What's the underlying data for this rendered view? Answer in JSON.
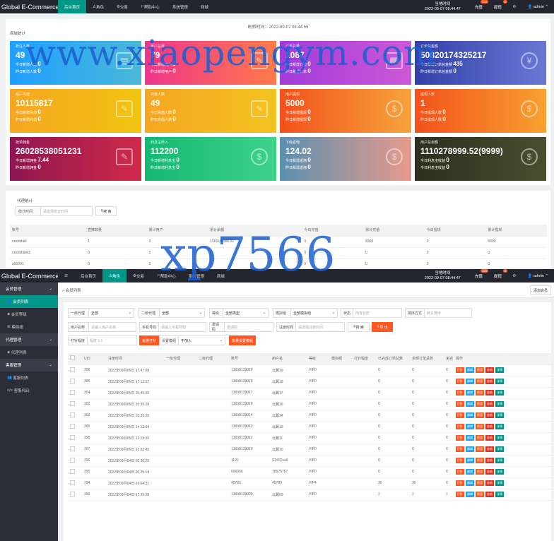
{
  "app_title": "Global E-Commerce...",
  "nav": [
    "后台首页",
    "角色",
    "交易",
    "帮助中心",
    "系统管理",
    "商城"
  ],
  "nav2": [
    "后台首页",
    "角色",
    "交易",
    "帮助中心",
    "系统管理",
    "商城"
  ],
  "header": {
    "time_label": "当地时间",
    "time_value": "2022-09-07 08:44:47",
    "recharge": "充值",
    "recharge_badge": "123",
    "withdraw": "提现",
    "withdraw_badge": "0",
    "user": "admin",
    "refresh_icon": "refresh-icon"
  },
  "dashboard": {
    "refresh_time": "刷新时间：2022-09-07 08:44:55",
    "section_title": "商城统计",
    "cards": [
      {
        "title": "新注人数",
        "value": "49",
        "l1": "今日新增人数",
        "l1v": "0",
        "l2": "昨日新增人数",
        "l2v": "0",
        "icon": "stack-icon",
        "color": "#1e9fff,#4bb8d8"
      },
      {
        "title": "用户总数",
        "value": "79",
        "l1": "今日新增用户",
        "l1v": "0",
        "l2": "昨日新增用户",
        "l2v": "0",
        "icon": "user-icon",
        "color": "#f0358c,#ff7a4a"
      },
      {
        "title": "订单总量",
        "value": "1087",
        "l1": "今日新增订单",
        "l1v": "0",
        "l2": "昨日新增订单",
        "l2v": "0",
        "icon": "book-icon",
        "color": "#a23bd8,#cc59d6"
      },
      {
        "title": "订单总金额",
        "value": "50820174325217",
        "l1": "今日新增订单总金额",
        "l1v": "435",
        "l2": "昨日新增订单总金额",
        "l2v": "0",
        "icon": "yen-icon",
        "color": "#3340a8,#6a78d4"
      },
      {
        "title": "用户充值",
        "value": "10115817",
        "l1": "今日新增充值",
        "l1v": "0",
        "l2": "昨日新增充值",
        "l2v": "0",
        "icon": "edit-icon",
        "color": "#f5a623,#f1c40f"
      },
      {
        "title": "充值人数",
        "value": "49",
        "l1": "今日充值人数",
        "l1v": "0",
        "l2": "昨日充值人数",
        "l2v": "0",
        "icon": "edit-icon",
        "color": "#f5a623,#f3c320"
      },
      {
        "title": "用户提现",
        "value": "5000",
        "l1": "今日新增提现",
        "l1v": "0",
        "l2": "昨日新增提现",
        "l2v": "0",
        "icon": "dollar-icon",
        "color": "#f2511b,#f7a33c"
      },
      {
        "title": "提现人数",
        "value": "1",
        "l1": "今日提现人数",
        "l1v": "0",
        "l2": "昨日提现人数",
        "l2v": "0",
        "icon": "dollar-icon",
        "color": "#f2511b,#f8a130"
      },
      {
        "title": "抢单佣金",
        "value": "26028538051231",
        "l1": "今日新增佣金",
        "l1v": "7.44",
        "l2": "昨日新增佣金",
        "l2v": "0",
        "icon": "user-icon",
        "color": "#8e1650,#d02a4a"
      },
      {
        "title": "利息宝转入",
        "value": "112200",
        "l1": "今日新增利息宝",
        "l1v": "0",
        "l2": "昨日新增利息宝",
        "l2v": "0",
        "icon": "dollar-icon",
        "color": "#14b874,#3fd28a"
      },
      {
        "title": "下级返佣",
        "value": "124.02",
        "l1": "今日新增返佣",
        "l1v": "0",
        "l2": "昨日新增返佣",
        "l2v": "0",
        "icon": "dollar-icon",
        "color": "#5b8fb0,#e89a8c"
      },
      {
        "title": "用户总余额",
        "value": "1110278999.52(9999)",
        "l1": "今日利息宝收益",
        "l1v": "0",
        "l2": "今日利息宝收益",
        "l2v": "0",
        "icon": "dollar-icon",
        "color": "#2c2f1c,#4a4e30"
      }
    ],
    "agent": {
      "title": "代理统计",
      "time_label": "统计时间",
      "time_placeholder": "请选择统计时间",
      "search_btn": "搜 索",
      "columns": [
        "账号",
        "直推数量",
        "累计用户",
        "累计余额",
        "今日充值",
        "累计充值",
        "今日提现",
        "累计提现"
      ],
      "rows": [
        [
          "ceshidaili",
          "1",
          "3",
          "1119145586.52",
          "0",
          "8300",
          "0",
          "5000"
        ],
        [
          "ceshidaili02",
          "0",
          "0",
          "0",
          "0",
          "0",
          "0",
          "0"
        ],
        [
          "a00001",
          "0",
          "0",
          "0",
          "0",
          "0",
          "0",
          "0"
        ]
      ]
    }
  },
  "watermarks": [
    "www.xiaopengym.com",
    "xp7566"
  ],
  "sidebar": {
    "groups": [
      {
        "label": "会员管理",
        "items": [
          "会员列表",
          "会员等级",
          "模拟组"
        ]
      },
      {
        "label": "代理管理",
        "items": [
          "代理列表"
        ]
      },
      {
        "label": "客服管理",
        "items": [
          "客服列表",
          "客服代码"
        ]
      }
    ]
  },
  "members": {
    "breadcrumb": "会员列表",
    "add_btn": "添加会员",
    "filters": {
      "f1_label": "一级代理",
      "f1_value": "全部",
      "f2_label": "二级代理",
      "f2_value": "全部",
      "f3_label": "等级",
      "f3_value": "全部类型",
      "f4_label": "模拟组",
      "f4_value": "全部模拟组",
      "f5_label": "状态",
      "f5_value": "所有状态",
      "f6_label": "排序方式",
      "f6_value": "默认排序",
      "name_label": "用户名称",
      "name_ph": "请输入用户名称",
      "phone_label": "手机号码",
      "phone_ph": "请输入手机号码",
      "invite_label": "邀请码",
      "invite_ph": "邀请码",
      "regtime_label": "注册时间",
      "regtime_ph": "请选择注册时间",
      "search": "搜 索",
      "export": "导 出",
      "batch_label": "打针幅度",
      "batch_ph": "幅度 1.1",
      "batch_btn": "批量打针",
      "setlevel_label": "设置模组",
      "setlevel_value": "不加入",
      "setlevel_btn": "批量设置模组"
    },
    "columns": [
      "UID",
      "注册时间",
      "一级代理",
      "二级代理",
      "账号",
      "用户名",
      "等级",
      "模拟组",
      "打针幅度",
      "已完成订单总数",
      "全部订单总数",
      "未完",
      "操作"
    ],
    "ops": [
      "打针",
      "编辑",
      "禁用",
      "冻结",
      "详情"
    ],
    "op_colors": [
      "#ff5722",
      "#1e9fff",
      "#ff5722",
      "#e0301e",
      "#009688"
    ],
    "rows": [
      [
        "306",
        "2022年09月05日 17:47:00",
        "",
        "",
        "13600139019",
        "北翼19",
        "VIP0",
        "",
        "",
        "0",
        "0",
        "0"
      ],
      [
        "305",
        "2022年09月05日 17:12:57",
        "",
        "",
        "13600139018",
        "北翼18",
        "VIP0",
        "",
        "",
        "0",
        "0",
        "0"
      ],
      [
        "304",
        "2022年09月05日 15:45:06",
        "",
        "",
        "13600139017",
        "北翼17",
        "VIP0",
        "",
        "",
        "0",
        "0",
        "0"
      ],
      [
        "303",
        "2022年09月05日 15:35:20",
        "",
        "",
        "13600139016",
        "北翼16",
        "VIP0",
        "",
        "",
        "0",
        "0",
        "0"
      ],
      [
        "302",
        "2022年09月05日 15:26:26",
        "",
        "",
        "13600139014",
        "北翼14",
        "VIP0",
        "",
        "",
        "0",
        "0",
        "0"
      ],
      [
        "300",
        "2022年09月05日 14:13:04",
        "",
        "",
        "13600139013",
        "北翼13",
        "VIP0",
        "",
        "",
        "0",
        "0",
        "0"
      ],
      [
        "298",
        "2022年09月05日 13:19:36",
        "",
        "",
        "13600139011",
        "北翼11",
        "VIP0",
        "",
        "",
        "0",
        "0",
        "0"
      ],
      [
        "297",
        "2022年09月05日 12:22:45",
        "",
        "",
        "13600139010",
        "北翼10",
        "VIP0",
        "",
        "",
        "0",
        "0",
        "0"
      ],
      [
        "296",
        "2022年09月04日 20:30:26",
        "",
        "",
        "1122",
        "S2432sa6",
        "VIP0",
        "",
        "",
        "0",
        "0",
        "0"
      ],
      [
        "295",
        "2022年09月04日 20:25:14",
        "",
        "",
        "666666",
        "78575757",
        "VIP0",
        "",
        "",
        "0",
        "0",
        "0"
      ],
      [
        "294",
        "2022年09月04日 19:04:31",
        "",
        "",
        "45789",
        "45789",
        "VIP4",
        "",
        "",
        "30",
        "30",
        "0"
      ],
      [
        "293",
        "2022年09月04日 17:39:30",
        "",
        "",
        "13600139009",
        "北翼09",
        "VIP0",
        "",
        "",
        "2",
        "2",
        "1"
      ]
    ]
  }
}
